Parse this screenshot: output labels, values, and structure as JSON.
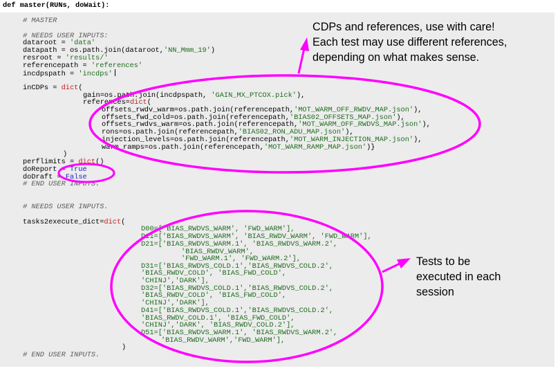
{
  "code": {
    "def_line": "def master(RUNs, doWait):",
    "c_master": "# MASTER",
    "c_needs": "# NEEDS USER INPUTS:",
    "l_dataroot": "dataroot = ",
    "v_dataroot": "'data'",
    "l_datapath": "datapath = os.path.join(dataroot,",
    "v_datapath": "'NN_Mmm_19'",
    "l_datapath_end": ")",
    "l_resroot": "resroot = ",
    "v_resroot": "'results/'",
    "l_refpath": "referencepath = ",
    "v_refpath": "'references'",
    "l_incdps": "incdpspath = ",
    "v_incdps": "'incdps'",
    "l_incCDPs": "inCDPs = ",
    "k_dict": "dict",
    "l_incCDPs_end": "(",
    "l_gain": "gain=os.path.join(incdpspath, ",
    "v_gain": "'GAIN_MX_PTCOX.pick'",
    "l_gain_end": "),",
    "l_refs": "references=",
    "l_refs_end": "(",
    "l_off_rwdv": "offsets_rwdv_warm=os.path.join(referencepath,",
    "v_off_rwdv": "'MOT_WARM_OFF_RWDV_MAP.json'",
    "l_off_fwd": "offsets_fwd_cold=os.path.join(referencepath,",
    "v_off_fwd": "'BIAS02_OFFSETS_MAP.json'",
    "l_off_rwdvs": "offsets_rwdvs_warm=os.path.join(referencepath,",
    "v_off_rwdvs": "'MOT_WARM_OFF_RWDVS_MAP.json'",
    "l_rons": "rons=os.path.join(referencepath,",
    "v_rons": "'BIAS02_RON_ADU_MAP.json'",
    "l_inj": "injection_levels=os.path.join(referencepath,",
    "v_inj": "'MOT_WARM_INJECTION_MAP.json'",
    "l_ramps": "warm_ramps=os.path.join(referencepath,",
    "v_ramps": "'MOT_WARM_RAMP_MAP.json'",
    "l_ramps_end": ")}",
    "l_close": ")",
    "l_perf": "perflimits = ",
    "l_perf_end": "()",
    "l_doreport": "doReport = ",
    "v_true": "True",
    "l_dodraft": "doDraft = ",
    "v_false": "False",
    "c_end1": "# END USER INPUTS.",
    "c_needs2": "# NEEDS USER INPUTS.",
    "l_tasks": "tasks2execute_dict=",
    "l_tasks_end": "(",
    "t_d00": "D00=['BIAS_RWDVS_WARM', 'FWD_WARM'],",
    "t_d11": "D11=['BIAS_RWDVS_WARM', 'BIAS_RWDV_WARM', 'FWD_WARM'],",
    "t_d21a": "D21=['BIAS_RWDVS_WARM.1', 'BIAS_RWDVS_WARM.2',",
    "t_d21b": "'BIAS_RWDV_WARM',",
    "t_d21c": "'FWD_WARM.1', 'FWD_WARM.2'],",
    "t_d31a": "D31=['BIAS_RWDVS_COLD.1','BIAS_RWDVS_COLD.2',",
    "t_d31b": "'BIAS_RWDV_COLD', 'BIAS_FWD_COLD',",
    "t_d31c": "'CHINJ','DARK'],",
    "t_d32a": "D32=['BIAS_RWDVS_COLD.1','BIAS_RWDVS_COLD.2',",
    "t_d32b": "'BIAS_RWDV_COLD', 'BIAS_FWD_COLD',",
    "t_d32c": "'CHINJ','DARK'],",
    "t_d41a": "D41=['BIAS_RWDVS_COLD.1','BIAS_RWDVS_COLD.2',",
    "t_d41b": "'BIAS_RWDV_COLD.1', 'BIAS_FWD_COLD',",
    "t_d41c": "'CHINJ','DARK', 'BIAS_RWDV_COLD.2'],",
    "t_d51a": "D51=['BIAS_RWDVS_WARM.1', 'BIAS_RWDVS_WARM.2',",
    "t_d51b": "'BIAS_RWDV_WARM','FWD_WARM'],",
    "l_close2": ")",
    "c_end2": "# END USER INPUTS."
  },
  "annotations": {
    "cdps_note": "CDPs and references, use with care!\nEach test may use different references,\ndepending on what makes sense.",
    "tests_note": "Tests to be\nexecuted in each\nsession"
  },
  "colors": {
    "highlight": "#ff00ff",
    "panel": "#ececec",
    "string": "#1e6b1e",
    "keyword": "#c02020",
    "boolean": "#2020c0"
  }
}
